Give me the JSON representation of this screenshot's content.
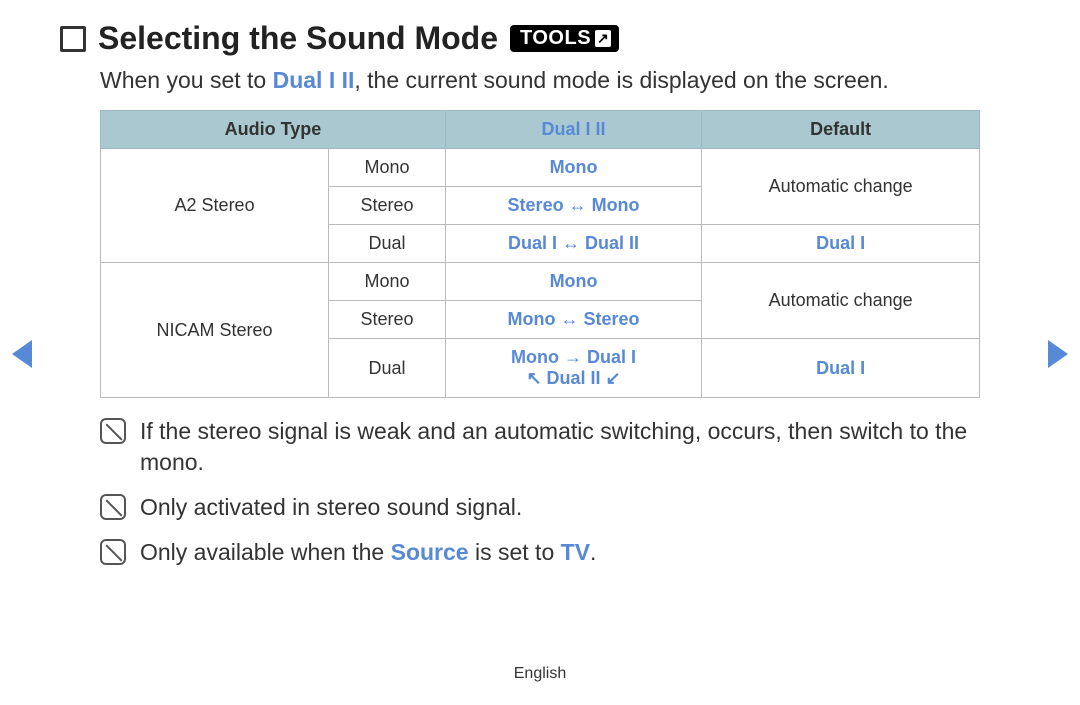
{
  "header": {
    "title": "Selecting the Sound Mode",
    "tools_label": "TOOLS"
  },
  "intro": {
    "prefix": "When you set to ",
    "highlight": "Dual I II",
    "suffix": ", the current sound mode is displayed on the screen."
  },
  "table": {
    "headers": {
      "col1": "Audio Type",
      "col2": "Dual I II",
      "col3": "Default"
    },
    "groups": [
      {
        "label": "A2 Stereo",
        "rows": [
          {
            "type": "Mono",
            "dual": "Mono",
            "default_merge": "Automatic change"
          },
          {
            "type": "Stereo",
            "dual": "Stereo ↔ Mono",
            "default_merge": null
          },
          {
            "type": "Dual",
            "dual": "Dual I ↔ Dual II",
            "default": "Dual I"
          }
        ]
      },
      {
        "label": "NICAM Stereo",
        "rows": [
          {
            "type": "Mono",
            "dual": "Mono",
            "default_merge": "Automatic change"
          },
          {
            "type": "Stereo",
            "dual": "Mono ↔ Stereo",
            "default_merge": null
          },
          {
            "type": "Dual",
            "dual_line1": "Mono → Dual I",
            "dual_line2": "↖ Dual II ↙",
            "default": "Dual I"
          }
        ]
      }
    ]
  },
  "notes": {
    "n1": "If the stereo signal is weak and an automatic switching, occurs, then switch to the mono.",
    "n2": "Only activated in stereo sound signal.",
    "n3_prefix": "Only available when the ",
    "n3_hl1": "Source",
    "n3_mid": " is set to ",
    "n3_hl2": "TV",
    "n3_suffix": "."
  },
  "footer": {
    "language": "English"
  }
}
